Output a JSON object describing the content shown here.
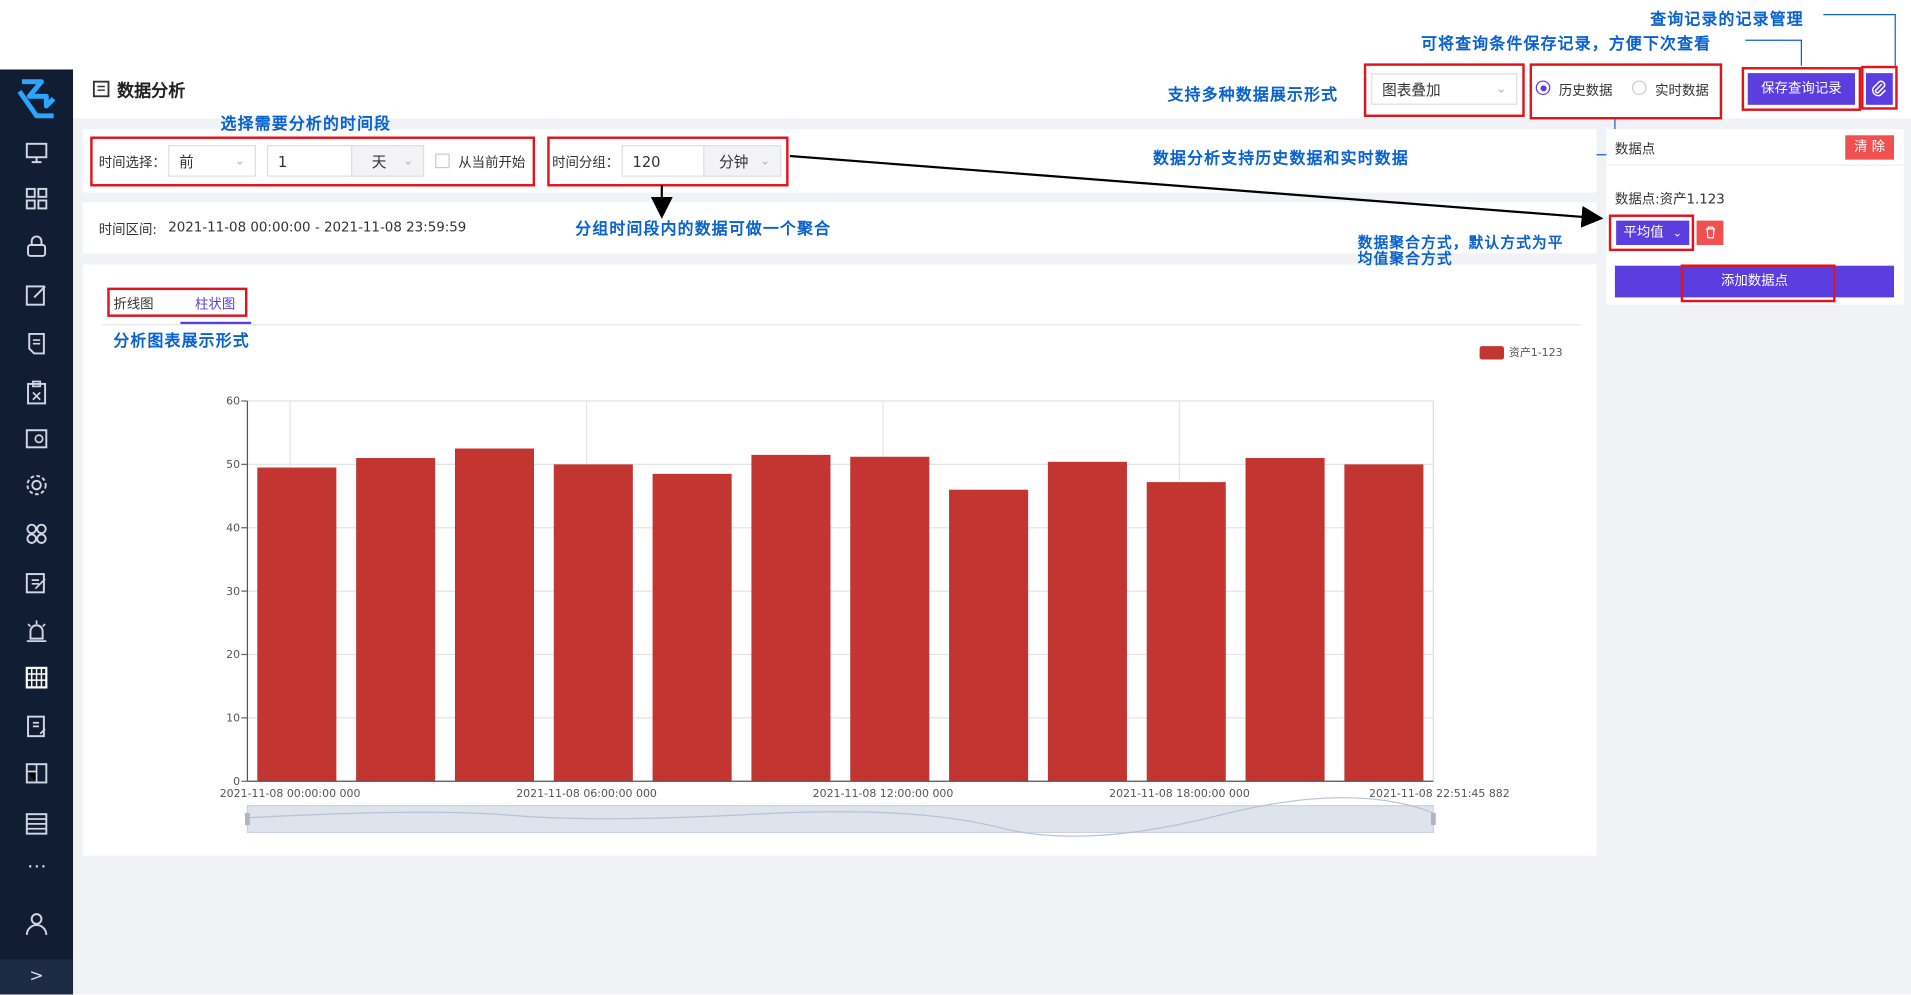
{
  "page": {
    "title": "数据分析"
  },
  "toolbar": {
    "display_mode": "图表叠加",
    "radio_history": "历史数据",
    "radio_realtime": "实时数据",
    "save_button": "保存查询记录"
  },
  "filters": {
    "time_select_label": "时间选择：",
    "time_direction": "前",
    "time_amount": "1",
    "time_unit": "天",
    "from_now_label": "从当前开始",
    "group_label": "时间分组：",
    "group_amount": "120",
    "group_unit": "分钟",
    "range_label": "时间区间:",
    "range_value": "2021-11-08 00:00:00 - 2021-11-08 23:59:59"
  },
  "tabs": [
    {
      "label": "折线图"
    },
    {
      "label": "柱状图"
    }
  ],
  "datapoints": {
    "title": "数据点",
    "clear_button": "清 除",
    "item_label": "数据点:资产1.123",
    "aggregation": "平均值",
    "add_button": "添加数据点"
  },
  "annotations": {
    "record_manage": "查询记录的记录管理",
    "save_conditions": "可将查询条件保存记录，方便下次查看",
    "display_forms": "支持多种数据展示形式",
    "time_range": "选择需要分析的时间段",
    "history_realtime": "数据分析支持历史数据和实时数据",
    "group_aggregate": "分组时间段内的数据可做一个聚合",
    "aggregation_line1": "数据聚合方式，默认方式为平",
    "aggregation_line2": "均值聚合方式",
    "chart_forms": "分析图表展示形式"
  },
  "colors": {
    "accent": "#5b3ee0",
    "bar": "#c23531",
    "sidebar": "#111d33",
    "annotation": "#0a62d0",
    "highlight": "#e0141e"
  },
  "chart_data": {
    "type": "bar",
    "series": [
      {
        "name": "资产1-123",
        "values": [
          49.5,
          51,
          52.5,
          50,
          48.5,
          51.5,
          51.2,
          46,
          50.4,
          47.2,
          51,
          50
        ]
      }
    ],
    "ylim": [
      0,
      60
    ],
    "yticks": [
      0,
      10,
      20,
      30,
      40,
      50,
      60
    ],
    "xtick_labels": [
      "2021-11-08 00:00:00 000",
      "2021-11-08 06:00:00 000",
      "2021-11-08 12:00:00 000",
      "2021-11-08 18:00:00 000",
      "2021-11-08 22:51:45 882"
    ],
    "legend_position": "top-right",
    "grid": true
  }
}
